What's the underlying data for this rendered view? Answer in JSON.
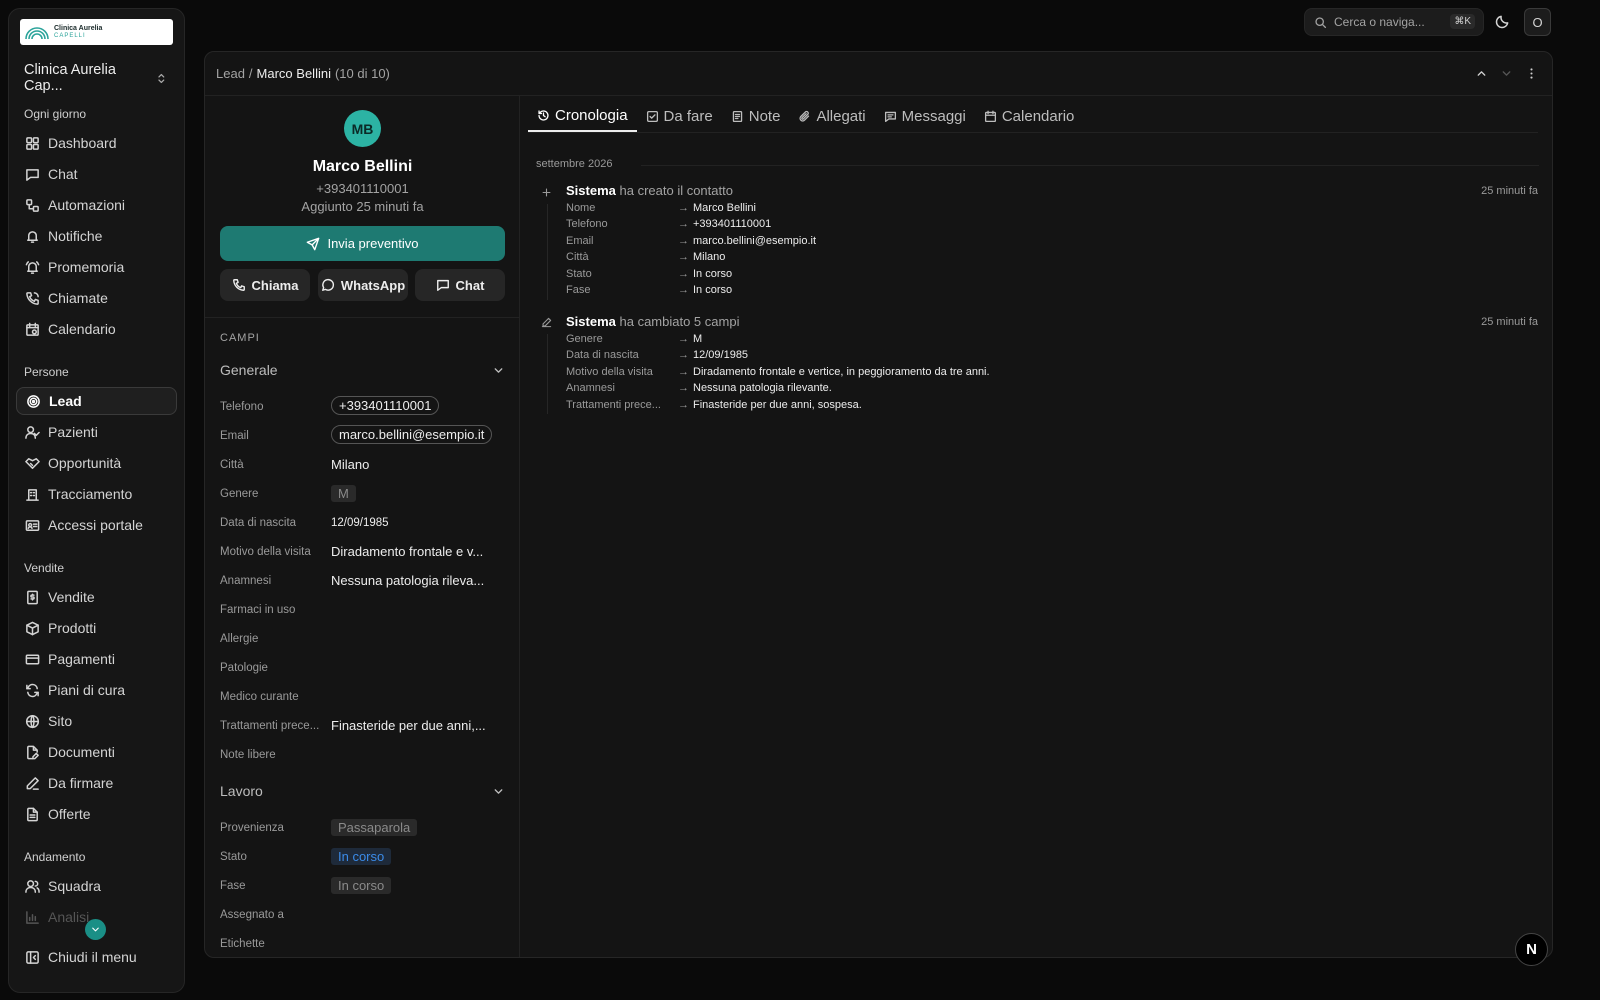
{
  "brand": {
    "logo_line1": "Clinica Aurelia",
    "logo_line2": "CAPELLI",
    "org_name": "Clinica Aurelia Cap..."
  },
  "sidebar": {
    "sections": [
      {
        "label": "Ogni giorno",
        "items": [
          "Dashboard",
          "Chat",
          "Automazioni",
          "Notifiche",
          "Promemoria",
          "Chiamate",
          "Calendario"
        ]
      },
      {
        "label": "Persone",
        "items": [
          "Lead",
          "Pazienti",
          "Opportunità",
          "Tracciamento",
          "Accessi portale"
        ]
      },
      {
        "label": "Vendite",
        "items": [
          "Vendite",
          "Prodotti",
          "Pagamenti",
          "Piani di cura",
          "Sito",
          "Documenti",
          "Da firmare",
          "Offerte"
        ]
      },
      {
        "label": "Andamento",
        "items": [
          "Squadra",
          "Analisi"
        ]
      }
    ],
    "active_item": "Lead",
    "close_menu": "Chiudi il menu"
  },
  "topbar": {
    "search_placeholder": "Cerca o naviga...",
    "shortcut": "⌘K",
    "user_initial": "O"
  },
  "breadcrumb": {
    "root": "Lead",
    "separator": "/",
    "current": "Marco Bellini",
    "count": "(10 di 10)"
  },
  "contact": {
    "initials": "MB",
    "name": "Marco Bellini",
    "phone": "+393401110001",
    "added": "Aggiunto 25 minuti fa",
    "primary_action": "Invia preventivo",
    "actions": [
      "Chiama",
      "WhatsApp",
      "Chat"
    ]
  },
  "fields": {
    "title": "CAMPI",
    "groups": [
      {
        "name": "Generale",
        "rows": [
          {
            "label": "Telefono",
            "value": "+393401110001",
            "style": "pill"
          },
          {
            "label": "Email",
            "value": "marco.bellini@esempio.it",
            "style": "pill"
          },
          {
            "label": "Città",
            "value": "Milano",
            "style": "plain"
          },
          {
            "label": "Genere",
            "value": "M",
            "style": "tag"
          },
          {
            "label": "Data di nascita",
            "value": "12/09/1985",
            "style": "small"
          },
          {
            "label": "Motivo della visita",
            "value": "Diradamento frontale e v...",
            "style": "plain"
          },
          {
            "label": "Anamnesi",
            "value": "Nessuna patologia rileva...",
            "style": "plain"
          },
          {
            "label": "Farmaci in uso",
            "value": "",
            "style": "empty"
          },
          {
            "label": "Allergie",
            "value": "",
            "style": "empty"
          },
          {
            "label": "Patologie",
            "value": "",
            "style": "empty"
          },
          {
            "label": "Medico curante",
            "value": "",
            "style": "empty"
          },
          {
            "label": "Trattamenti prece...",
            "value": "Finasteride per due anni,...",
            "style": "plain"
          },
          {
            "label": "Note libere",
            "value": "",
            "style": "empty"
          }
        ]
      },
      {
        "name": "Lavoro",
        "rows": [
          {
            "label": "Provenienza",
            "value": "Passaparola",
            "style": "tag"
          },
          {
            "label": "Stato",
            "value": "In corso",
            "style": "tag-blue"
          },
          {
            "label": "Fase",
            "value": "In corso",
            "style": "tag"
          },
          {
            "label": "Assegnato a",
            "value": "",
            "style": "empty"
          },
          {
            "label": "Etichette",
            "value": "",
            "style": "empty"
          }
        ]
      }
    ]
  },
  "tabs": [
    "Cronologia",
    "Da fare",
    "Note",
    "Allegati",
    "Messaggi",
    "Calendario"
  ],
  "active_tab": "Cronologia",
  "timeline": {
    "month": "settembre 2026",
    "events": [
      {
        "actor": "Sistema",
        "action": "ha creato il contatto",
        "time": "25 minuti fa",
        "changes": [
          {
            "field": "Nome",
            "value": "Marco Bellini"
          },
          {
            "field": "Telefono",
            "value": "+393401110001"
          },
          {
            "field": "Email",
            "value": "marco.bellini@esempio.it"
          },
          {
            "field": "Città",
            "value": "Milano"
          },
          {
            "field": "Stato",
            "value": "In corso"
          },
          {
            "field": "Fase",
            "value": "In corso"
          }
        ]
      },
      {
        "actor": "Sistema",
        "action": "ha cambiato 5 campi",
        "time": "25 minuti fa",
        "changes": [
          {
            "field": "Genere",
            "value": "M"
          },
          {
            "field": "Data di nascita",
            "value": "12/09/1985"
          },
          {
            "field": "Motivo della visita",
            "value": "Diradamento frontale e vertice, in peggioramento da tre anni."
          },
          {
            "field": "Anamnesi",
            "value": "Nessuna patologia rilevante."
          },
          {
            "field": "Trattamenti prece...",
            "value": "Finasteride per due anni, sospesa."
          }
        ]
      }
    ]
  },
  "badge": "N",
  "colors": {
    "accent": "#1e7a72",
    "avatar": "#2cb3a4",
    "status_blue": "#3b8be8"
  }
}
